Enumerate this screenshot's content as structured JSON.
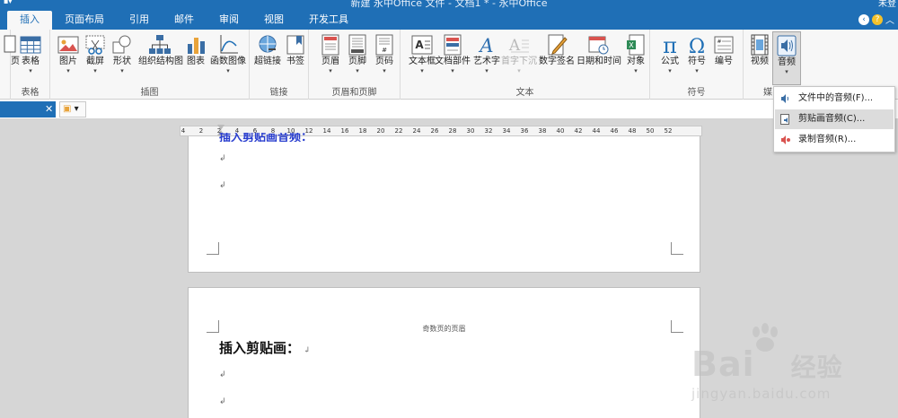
{
  "window": {
    "title": "新建 永中Office 文件 - 文档1 * - 永中Office",
    "user": "未登"
  },
  "tabs": [
    "插入",
    "页面布局",
    "引用",
    "邮件",
    "审阅",
    "视图",
    "开发工具"
  ],
  "ribbon": {
    "groups": {
      "table": "表格",
      "illustrations": "插图",
      "links": "链接",
      "header_footer": "页眉和页脚",
      "text": "文本",
      "symbols": "符号",
      "media": "媒"
    },
    "buttons": {
      "page": "页",
      "table": "表格",
      "picture": "图片",
      "screenshot": "截屏",
      "shapes": "形状",
      "smartart": "组织结构图",
      "chart": "图表",
      "function_graph": "函数图像",
      "hyperlink": "超链接",
      "bookmark": "书签",
      "header": "页眉",
      "footer": "页脚",
      "page_number": "页码",
      "textbox": "文本框",
      "doc_parts": "文档部件",
      "wordart": "艺术字",
      "dropcap": "首字下沉",
      "signature": "数字签名",
      "datetime": "日期和时间",
      "object": "对象",
      "equation": "公式",
      "symbol": "符号",
      "numbering": "编号",
      "video": "视频",
      "audio": "音频"
    }
  },
  "audio_menu": {
    "items": [
      "文件中的音频(F)...",
      "剪贴画音频(C)...",
      "录制音频(R)..."
    ]
  },
  "ruler": {
    "ticks": [
      "4",
      "2",
      "2",
      "4",
      "6",
      "8",
      "10",
      "12",
      "14",
      "16",
      "18",
      "20",
      "22",
      "24",
      "26",
      "28",
      "30",
      "32",
      "34",
      "36",
      "38",
      "40",
      "42",
      "44",
      "46",
      "48",
      "50",
      "52"
    ]
  },
  "document": {
    "page1_cut_link": "插入剪贴画音频：",
    "header_text": "奇数页的页眉",
    "heading": "插入剪贴画：",
    "para_mark": "↲"
  },
  "watermark": {
    "brand": "Bai",
    "brand2": "经验",
    "url": "jingyan.baidu.com"
  },
  "colors": {
    "accent": "#1f6fb6",
    "link": "#2a3fcf"
  }
}
